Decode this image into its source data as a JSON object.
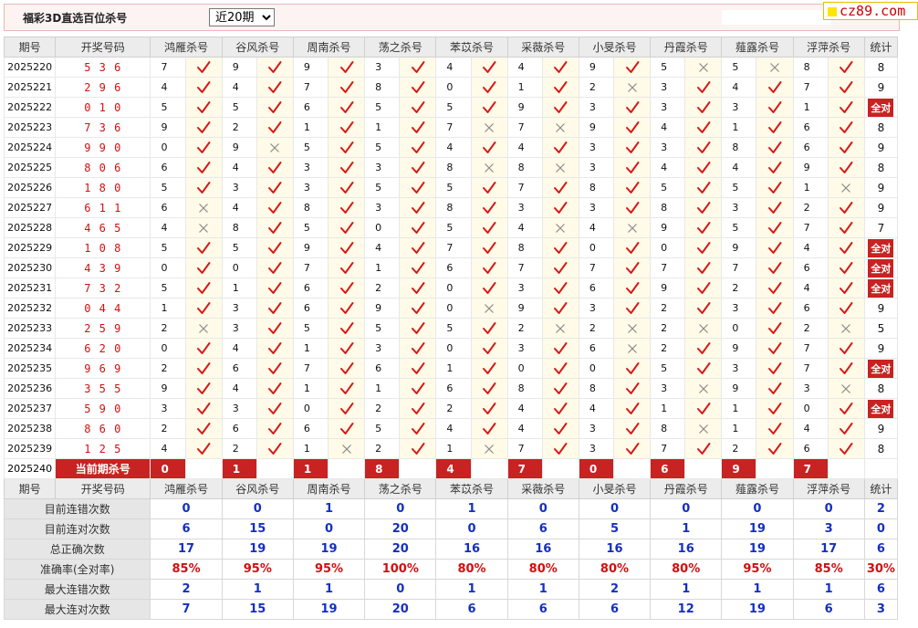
{
  "header": {
    "title": "福彩3D直选百位杀号",
    "period_select": "近20期",
    "period_options": [
      "近20期"
    ]
  },
  "logo": {
    "text": "cz89.com",
    "square_color": "#ffe600"
  },
  "colors": {
    "accent_red": "#c82222",
    "check_red": "#d81818",
    "cross_gray": "#8a8a8a",
    "stat_blue": "#1530c0",
    "rate_red": "#d01010"
  },
  "table": {
    "columns": [
      "期号",
      "开奖号码",
      "鸿雁杀号",
      "谷风杀号",
      "周南杀号",
      "荡之杀号",
      "苯苡杀号",
      "采薇杀号",
      "小旻杀号",
      "丹霞杀号",
      "薤露杀号",
      "浮萍杀号",
      "统计"
    ],
    "rows": [
      {
        "period": "2025220",
        "draw": "536",
        "kills": [
          {
            "n": "7",
            "ok": true
          },
          {
            "n": "9",
            "ok": true
          },
          {
            "n": "9",
            "ok": true
          },
          {
            "n": "3",
            "ok": true
          },
          {
            "n": "4",
            "ok": true
          },
          {
            "n": "4",
            "ok": true
          },
          {
            "n": "9",
            "ok": true
          },
          {
            "n": "5",
            "ok": false
          },
          {
            "n": "5",
            "ok": false
          },
          {
            "n": "8",
            "ok": true
          }
        ],
        "stat": "8"
      },
      {
        "period": "2025221",
        "draw": "296",
        "kills": [
          {
            "n": "4",
            "ok": true
          },
          {
            "n": "4",
            "ok": true
          },
          {
            "n": "7",
            "ok": true
          },
          {
            "n": "8",
            "ok": true
          },
          {
            "n": "0",
            "ok": true
          },
          {
            "n": "1",
            "ok": true
          },
          {
            "n": "2",
            "ok": false
          },
          {
            "n": "3",
            "ok": true
          },
          {
            "n": "4",
            "ok": true
          },
          {
            "n": "7",
            "ok": true
          }
        ],
        "stat": "9"
      },
      {
        "period": "2025222",
        "draw": "010",
        "kills": [
          {
            "n": "5",
            "ok": true
          },
          {
            "n": "5",
            "ok": true
          },
          {
            "n": "6",
            "ok": true
          },
          {
            "n": "5",
            "ok": true
          },
          {
            "n": "5",
            "ok": true
          },
          {
            "n": "9",
            "ok": true
          },
          {
            "n": "3",
            "ok": true
          },
          {
            "n": "3",
            "ok": true
          },
          {
            "n": "3",
            "ok": true
          },
          {
            "n": "1",
            "ok": true
          }
        ],
        "stat": "全对"
      },
      {
        "period": "2025223",
        "draw": "736",
        "kills": [
          {
            "n": "9",
            "ok": true
          },
          {
            "n": "2",
            "ok": true
          },
          {
            "n": "1",
            "ok": true
          },
          {
            "n": "1",
            "ok": true
          },
          {
            "n": "7",
            "ok": false
          },
          {
            "n": "7",
            "ok": false
          },
          {
            "n": "9",
            "ok": true
          },
          {
            "n": "4",
            "ok": true
          },
          {
            "n": "1",
            "ok": true
          },
          {
            "n": "6",
            "ok": true
          }
        ],
        "stat": "8"
      },
      {
        "period": "2025224",
        "draw": "990",
        "kills": [
          {
            "n": "0",
            "ok": true
          },
          {
            "n": "9",
            "ok": false
          },
          {
            "n": "5",
            "ok": true
          },
          {
            "n": "5",
            "ok": true
          },
          {
            "n": "4",
            "ok": true
          },
          {
            "n": "4",
            "ok": true
          },
          {
            "n": "3",
            "ok": true
          },
          {
            "n": "3",
            "ok": true
          },
          {
            "n": "8",
            "ok": true
          },
          {
            "n": "6",
            "ok": true
          }
        ],
        "stat": "9"
      },
      {
        "period": "2025225",
        "draw": "806",
        "kills": [
          {
            "n": "6",
            "ok": true
          },
          {
            "n": "4",
            "ok": true
          },
          {
            "n": "3",
            "ok": true
          },
          {
            "n": "3",
            "ok": true
          },
          {
            "n": "8",
            "ok": false
          },
          {
            "n": "8",
            "ok": false
          },
          {
            "n": "3",
            "ok": true
          },
          {
            "n": "4",
            "ok": true
          },
          {
            "n": "4",
            "ok": true
          },
          {
            "n": "9",
            "ok": true
          }
        ],
        "stat": "8"
      },
      {
        "period": "2025226",
        "draw": "180",
        "kills": [
          {
            "n": "5",
            "ok": true
          },
          {
            "n": "3",
            "ok": true
          },
          {
            "n": "3",
            "ok": true
          },
          {
            "n": "5",
            "ok": true
          },
          {
            "n": "5",
            "ok": true
          },
          {
            "n": "7",
            "ok": true
          },
          {
            "n": "8",
            "ok": true
          },
          {
            "n": "5",
            "ok": true
          },
          {
            "n": "5",
            "ok": true
          },
          {
            "n": "1",
            "ok": false
          }
        ],
        "stat": "9"
      },
      {
        "period": "2025227",
        "draw": "611",
        "kills": [
          {
            "n": "6",
            "ok": false
          },
          {
            "n": "4",
            "ok": true
          },
          {
            "n": "8",
            "ok": true
          },
          {
            "n": "3",
            "ok": true
          },
          {
            "n": "8",
            "ok": true
          },
          {
            "n": "3",
            "ok": true
          },
          {
            "n": "3",
            "ok": true
          },
          {
            "n": "8",
            "ok": true
          },
          {
            "n": "3",
            "ok": true
          },
          {
            "n": "2",
            "ok": true
          }
        ],
        "stat": "9"
      },
      {
        "period": "2025228",
        "draw": "465",
        "kills": [
          {
            "n": "4",
            "ok": false
          },
          {
            "n": "8",
            "ok": true
          },
          {
            "n": "5",
            "ok": true
          },
          {
            "n": "0",
            "ok": true
          },
          {
            "n": "5",
            "ok": true
          },
          {
            "n": "4",
            "ok": false
          },
          {
            "n": "4",
            "ok": false
          },
          {
            "n": "9",
            "ok": true
          },
          {
            "n": "5",
            "ok": true
          },
          {
            "n": "7",
            "ok": true
          }
        ],
        "stat": "7"
      },
      {
        "period": "2025229",
        "draw": "108",
        "kills": [
          {
            "n": "5",
            "ok": true
          },
          {
            "n": "5",
            "ok": true
          },
          {
            "n": "9",
            "ok": true
          },
          {
            "n": "4",
            "ok": true
          },
          {
            "n": "7",
            "ok": true
          },
          {
            "n": "8",
            "ok": true
          },
          {
            "n": "0",
            "ok": true
          },
          {
            "n": "0",
            "ok": true
          },
          {
            "n": "9",
            "ok": true
          },
          {
            "n": "4",
            "ok": true
          }
        ],
        "stat": "全对"
      },
      {
        "period": "2025230",
        "draw": "439",
        "kills": [
          {
            "n": "0",
            "ok": true
          },
          {
            "n": "0",
            "ok": true
          },
          {
            "n": "7",
            "ok": true
          },
          {
            "n": "1",
            "ok": true
          },
          {
            "n": "6",
            "ok": true
          },
          {
            "n": "7",
            "ok": true
          },
          {
            "n": "7",
            "ok": true
          },
          {
            "n": "7",
            "ok": true
          },
          {
            "n": "7",
            "ok": true
          },
          {
            "n": "6",
            "ok": true
          }
        ],
        "stat": "全对"
      },
      {
        "period": "2025231",
        "draw": "732",
        "kills": [
          {
            "n": "5",
            "ok": true
          },
          {
            "n": "1",
            "ok": true
          },
          {
            "n": "6",
            "ok": true
          },
          {
            "n": "2",
            "ok": true
          },
          {
            "n": "0",
            "ok": true
          },
          {
            "n": "3",
            "ok": true
          },
          {
            "n": "6",
            "ok": true
          },
          {
            "n": "9",
            "ok": true
          },
          {
            "n": "2",
            "ok": true
          },
          {
            "n": "4",
            "ok": true
          }
        ],
        "stat": "全对"
      },
      {
        "period": "2025232",
        "draw": "044",
        "kills": [
          {
            "n": "1",
            "ok": true
          },
          {
            "n": "3",
            "ok": true
          },
          {
            "n": "6",
            "ok": true
          },
          {
            "n": "9",
            "ok": true
          },
          {
            "n": "0",
            "ok": false
          },
          {
            "n": "9",
            "ok": true
          },
          {
            "n": "3",
            "ok": true
          },
          {
            "n": "2",
            "ok": true
          },
          {
            "n": "3",
            "ok": true
          },
          {
            "n": "6",
            "ok": true
          }
        ],
        "stat": "9"
      },
      {
        "period": "2025233",
        "draw": "259",
        "kills": [
          {
            "n": "2",
            "ok": false
          },
          {
            "n": "3",
            "ok": true
          },
          {
            "n": "5",
            "ok": true
          },
          {
            "n": "5",
            "ok": true
          },
          {
            "n": "5",
            "ok": true
          },
          {
            "n": "2",
            "ok": false
          },
          {
            "n": "2",
            "ok": false
          },
          {
            "n": "2",
            "ok": false
          },
          {
            "n": "0",
            "ok": true
          },
          {
            "n": "2",
            "ok": false
          }
        ],
        "stat": "5"
      },
      {
        "period": "2025234",
        "draw": "620",
        "kills": [
          {
            "n": "0",
            "ok": true
          },
          {
            "n": "4",
            "ok": true
          },
          {
            "n": "1",
            "ok": true
          },
          {
            "n": "3",
            "ok": true
          },
          {
            "n": "0",
            "ok": true
          },
          {
            "n": "3",
            "ok": true
          },
          {
            "n": "6",
            "ok": false
          },
          {
            "n": "2",
            "ok": true
          },
          {
            "n": "9",
            "ok": true
          },
          {
            "n": "7",
            "ok": true
          }
        ],
        "stat": "9"
      },
      {
        "period": "2025235",
        "draw": "969",
        "kills": [
          {
            "n": "2",
            "ok": true
          },
          {
            "n": "6",
            "ok": true
          },
          {
            "n": "7",
            "ok": true
          },
          {
            "n": "6",
            "ok": true
          },
          {
            "n": "1",
            "ok": true
          },
          {
            "n": "0",
            "ok": true
          },
          {
            "n": "0",
            "ok": true
          },
          {
            "n": "5",
            "ok": true
          },
          {
            "n": "3",
            "ok": true
          },
          {
            "n": "7",
            "ok": true
          }
        ],
        "stat": "全对"
      },
      {
        "period": "2025236",
        "draw": "355",
        "kills": [
          {
            "n": "9",
            "ok": true
          },
          {
            "n": "4",
            "ok": true
          },
          {
            "n": "1",
            "ok": true
          },
          {
            "n": "1",
            "ok": true
          },
          {
            "n": "6",
            "ok": true
          },
          {
            "n": "8",
            "ok": true
          },
          {
            "n": "8",
            "ok": true
          },
          {
            "n": "3",
            "ok": false
          },
          {
            "n": "9",
            "ok": true
          },
          {
            "n": "3",
            "ok": false
          }
        ],
        "stat": "8"
      },
      {
        "period": "2025237",
        "draw": "590",
        "kills": [
          {
            "n": "3",
            "ok": true
          },
          {
            "n": "3",
            "ok": true
          },
          {
            "n": "0",
            "ok": true
          },
          {
            "n": "2",
            "ok": true
          },
          {
            "n": "2",
            "ok": true
          },
          {
            "n": "4",
            "ok": true
          },
          {
            "n": "4",
            "ok": true
          },
          {
            "n": "1",
            "ok": true
          },
          {
            "n": "1",
            "ok": true
          },
          {
            "n": "0",
            "ok": true
          }
        ],
        "stat": "全对"
      },
      {
        "period": "2025238",
        "draw": "860",
        "kills": [
          {
            "n": "2",
            "ok": true
          },
          {
            "n": "6",
            "ok": true
          },
          {
            "n": "6",
            "ok": true
          },
          {
            "n": "5",
            "ok": true
          },
          {
            "n": "4",
            "ok": true
          },
          {
            "n": "4",
            "ok": true
          },
          {
            "n": "3",
            "ok": true
          },
          {
            "n": "8",
            "ok": false
          },
          {
            "n": "1",
            "ok": true
          },
          {
            "n": "4",
            "ok": true
          }
        ],
        "stat": "9"
      },
      {
        "period": "2025239",
        "draw": "125",
        "kills": [
          {
            "n": "4",
            "ok": true
          },
          {
            "n": "2",
            "ok": true
          },
          {
            "n": "1",
            "ok": false
          },
          {
            "n": "2",
            "ok": true
          },
          {
            "n": "1",
            "ok": false
          },
          {
            "n": "7",
            "ok": true
          },
          {
            "n": "3",
            "ok": true
          },
          {
            "n": "7",
            "ok": true
          },
          {
            "n": "2",
            "ok": true
          },
          {
            "n": "6",
            "ok": true
          }
        ],
        "stat": "8"
      }
    ],
    "current": {
      "period": "2025240",
      "label": "当前期杀号",
      "kills": [
        "0",
        "1",
        "1",
        "8",
        "4",
        "7",
        "0",
        "6",
        "9",
        "7"
      ]
    }
  },
  "stats": {
    "rows": [
      {
        "label": "目前连错次数",
        "values": [
          "0",
          "0",
          "1",
          "0",
          "1",
          "0",
          "0",
          "0",
          "0",
          "0",
          "2"
        ]
      },
      {
        "label": "目前连对次数",
        "values": [
          "6",
          "15",
          "0",
          "20",
          "0",
          "6",
          "5",
          "1",
          "19",
          "3",
          "0"
        ]
      },
      {
        "label": "总正确次数",
        "values": [
          "17",
          "19",
          "19",
          "20",
          "16",
          "16",
          "16",
          "16",
          "19",
          "17",
          "6"
        ]
      },
      {
        "label": "准确率(全对率)",
        "values": [
          "85%",
          "95%",
          "95%",
          "100%",
          "80%",
          "80%",
          "80%",
          "80%",
          "95%",
          "85%",
          "30%"
        ]
      },
      {
        "label": "最大连错次数",
        "values": [
          "2",
          "1",
          "1",
          "0",
          "1",
          "1",
          "2",
          "1",
          "1",
          "1",
          "6"
        ]
      },
      {
        "label": "最大连对次数",
        "values": [
          "7",
          "15",
          "19",
          "20",
          "6",
          "6",
          "6",
          "12",
          "19",
          "6",
          "3"
        ]
      }
    ]
  }
}
